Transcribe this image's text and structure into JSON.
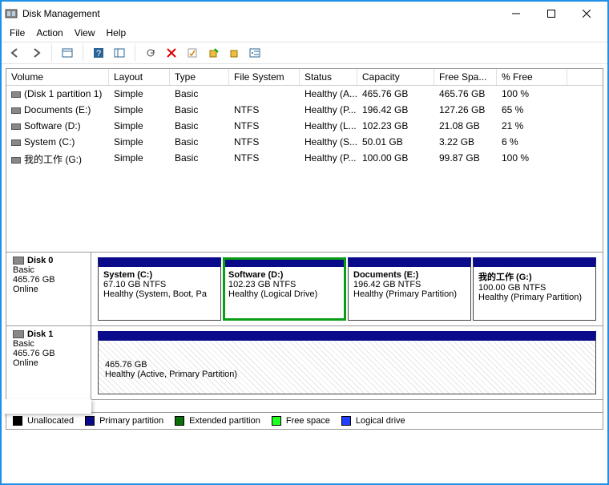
{
  "window": {
    "title": "Disk Management"
  },
  "menu": [
    "File",
    "Action",
    "View",
    "Help"
  ],
  "columns": [
    "Volume",
    "Layout",
    "Type",
    "File System",
    "Status",
    "Capacity",
    "Free Spa...",
    "% Free"
  ],
  "volumes": [
    {
      "name": "(Disk 1 partition 1)",
      "layout": "Simple",
      "type": "Basic",
      "fs": "",
      "status": "Healthy (A...",
      "capacity": "465.76 GB",
      "free": "465.76 GB",
      "pct": "100 %"
    },
    {
      "name": "Documents (E:)",
      "layout": "Simple",
      "type": "Basic",
      "fs": "NTFS",
      "status": "Healthy (P...",
      "capacity": "196.42 GB",
      "free": "127.26 GB",
      "pct": "65 %"
    },
    {
      "name": "Software (D:)",
      "layout": "Simple",
      "type": "Basic",
      "fs": "NTFS",
      "status": "Healthy (L...",
      "capacity": "102.23 GB",
      "free": "21.08 GB",
      "pct": "21 %"
    },
    {
      "name": "System (C:)",
      "layout": "Simple",
      "type": "Basic",
      "fs": "NTFS",
      "status": "Healthy (S...",
      "capacity": "50.01 GB",
      "free": "3.22 GB",
      "pct": "6 %"
    },
    {
      "name": "我的工作 (G:)",
      "layout": "Simple",
      "type": "Basic",
      "fs": "NTFS",
      "status": "Healthy (P...",
      "capacity": "100.00 GB",
      "free": "99.87 GB",
      "pct": "100 %"
    }
  ],
  "disks": [
    {
      "label": "Disk 0",
      "type": "Basic",
      "size": "465.76 GB",
      "state": "Online",
      "partitions": [
        {
          "name": "System  (C:)",
          "info": "67.10 GB NTFS",
          "status": "Healthy (System, Boot, Pa"
        },
        {
          "name": "Software  (D:)",
          "info": "102.23 GB NTFS",
          "status": "Healthy (Logical Drive)",
          "selected": true
        },
        {
          "name": "Documents  (E:)",
          "info": "196.42 GB NTFS",
          "status": "Healthy (Primary Partition)"
        },
        {
          "name": "我的工作  (G:)",
          "info": "100.00 GB NTFS",
          "status": "Healthy (Primary Partition)"
        }
      ]
    },
    {
      "label": "Disk 1",
      "type": "Basic",
      "size": "465.76 GB",
      "state": "Online",
      "single": {
        "info": "465.76 GB",
        "status": "Healthy (Active, Primary Partition)"
      }
    }
  ],
  "legend": [
    {
      "label": "Unallocated",
      "color": "#000"
    },
    {
      "label": "Primary partition",
      "color": "#0a0b8a"
    },
    {
      "label": "Extended partition",
      "color": "#0a6e0a"
    },
    {
      "label": "Free space",
      "color": "#22ff22"
    },
    {
      "label": "Logical drive",
      "color": "#2040ff"
    }
  ]
}
